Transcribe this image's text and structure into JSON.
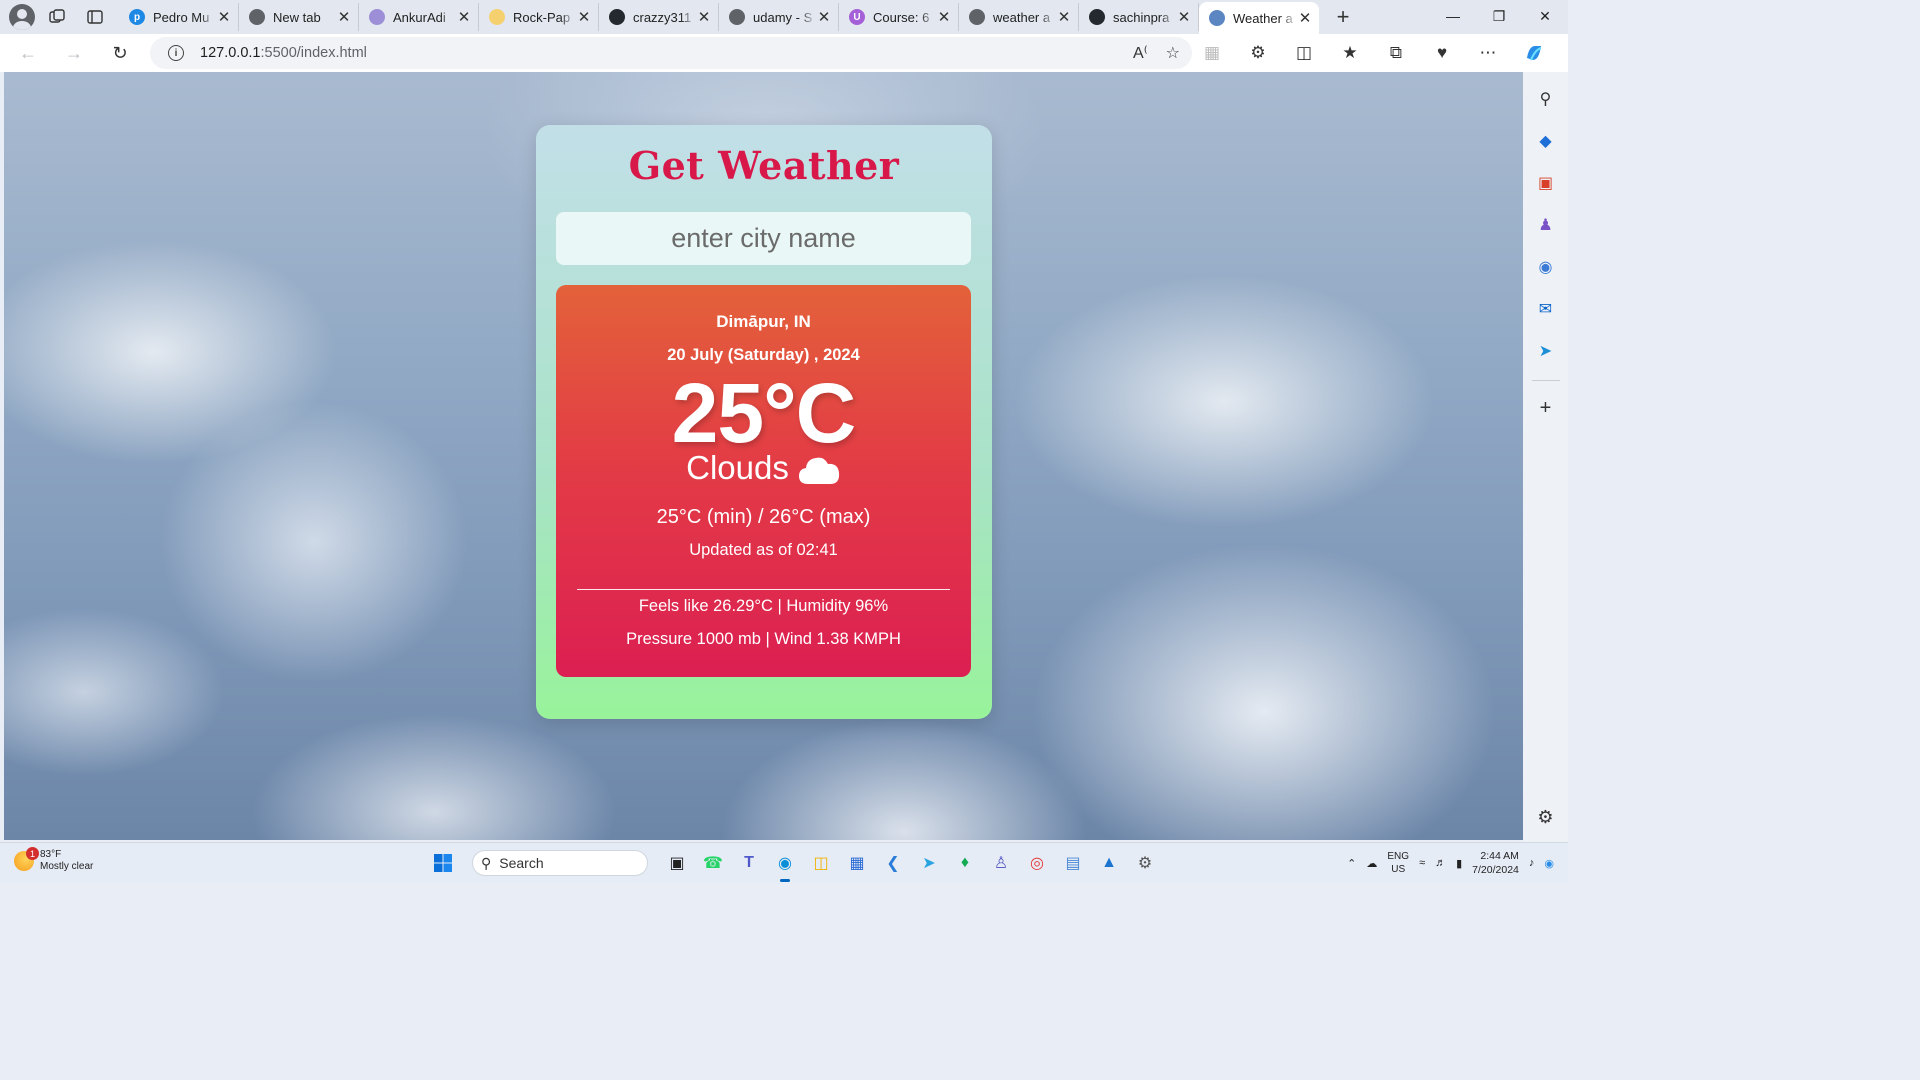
{
  "browser": {
    "tabs": [
      {
        "title": "Pedro Mu",
        "favicon_color": "#1e88e5",
        "favicon_char": "p"
      },
      {
        "title": "New tab",
        "favicon_color": "#5f6368",
        "favicon_char": ""
      },
      {
        "title": "AnkurAdi",
        "favicon_color": "#9c8fd8",
        "favicon_char": ""
      },
      {
        "title": "Rock-Pap",
        "favicon_color": "#f4d06f",
        "favicon_char": ""
      },
      {
        "title": "crazzy311",
        "favicon_color": "#24292f",
        "favicon_char": ""
      },
      {
        "title": "udamy - S",
        "favicon_color": "#5f6368",
        "favicon_char": ""
      },
      {
        "title": "Course: 6",
        "favicon_color": "#a560d8",
        "favicon_char": "U"
      },
      {
        "title": "weather a",
        "favicon_color": "#5f6368",
        "favicon_char": ""
      },
      {
        "title": "sachinpra",
        "favicon_color": "#24292f",
        "favicon_char": ""
      },
      {
        "title": "Weather a",
        "favicon_color": "#5b86c2",
        "favicon_char": "",
        "active": true
      }
    ],
    "address": {
      "host": "127.0.0.1",
      "rest": ":5500/index.html"
    }
  },
  "app": {
    "title": "Get Weather",
    "search_placeholder": "enter city name",
    "location": "Dimāpur, IN",
    "date": "20 July (Saturday) , 2024",
    "temperature": "25°C",
    "condition": "Clouds",
    "condition_icon": "cloud-icon",
    "min_max": "25°C (min) / 26°C (max)",
    "updated": "Updated as of 02:41",
    "feels_humidity": "Feels like 26.29°C | Humidity 96%",
    "pressure_wind": "Pressure 1000 mb | Wind 1.38 KMPH",
    "colors": {
      "title": "#d9184a",
      "card_top": "#e3623a",
      "card_bottom": "#dc1f52"
    }
  },
  "taskbar": {
    "weather_temp": "83°F",
    "weather_desc": "Mostly clear",
    "weather_badge": "1",
    "search_label": "Search",
    "lang_line1": "ENG",
    "lang_line2": "US",
    "time": "2:44 AM",
    "date": "7/20/2024"
  }
}
